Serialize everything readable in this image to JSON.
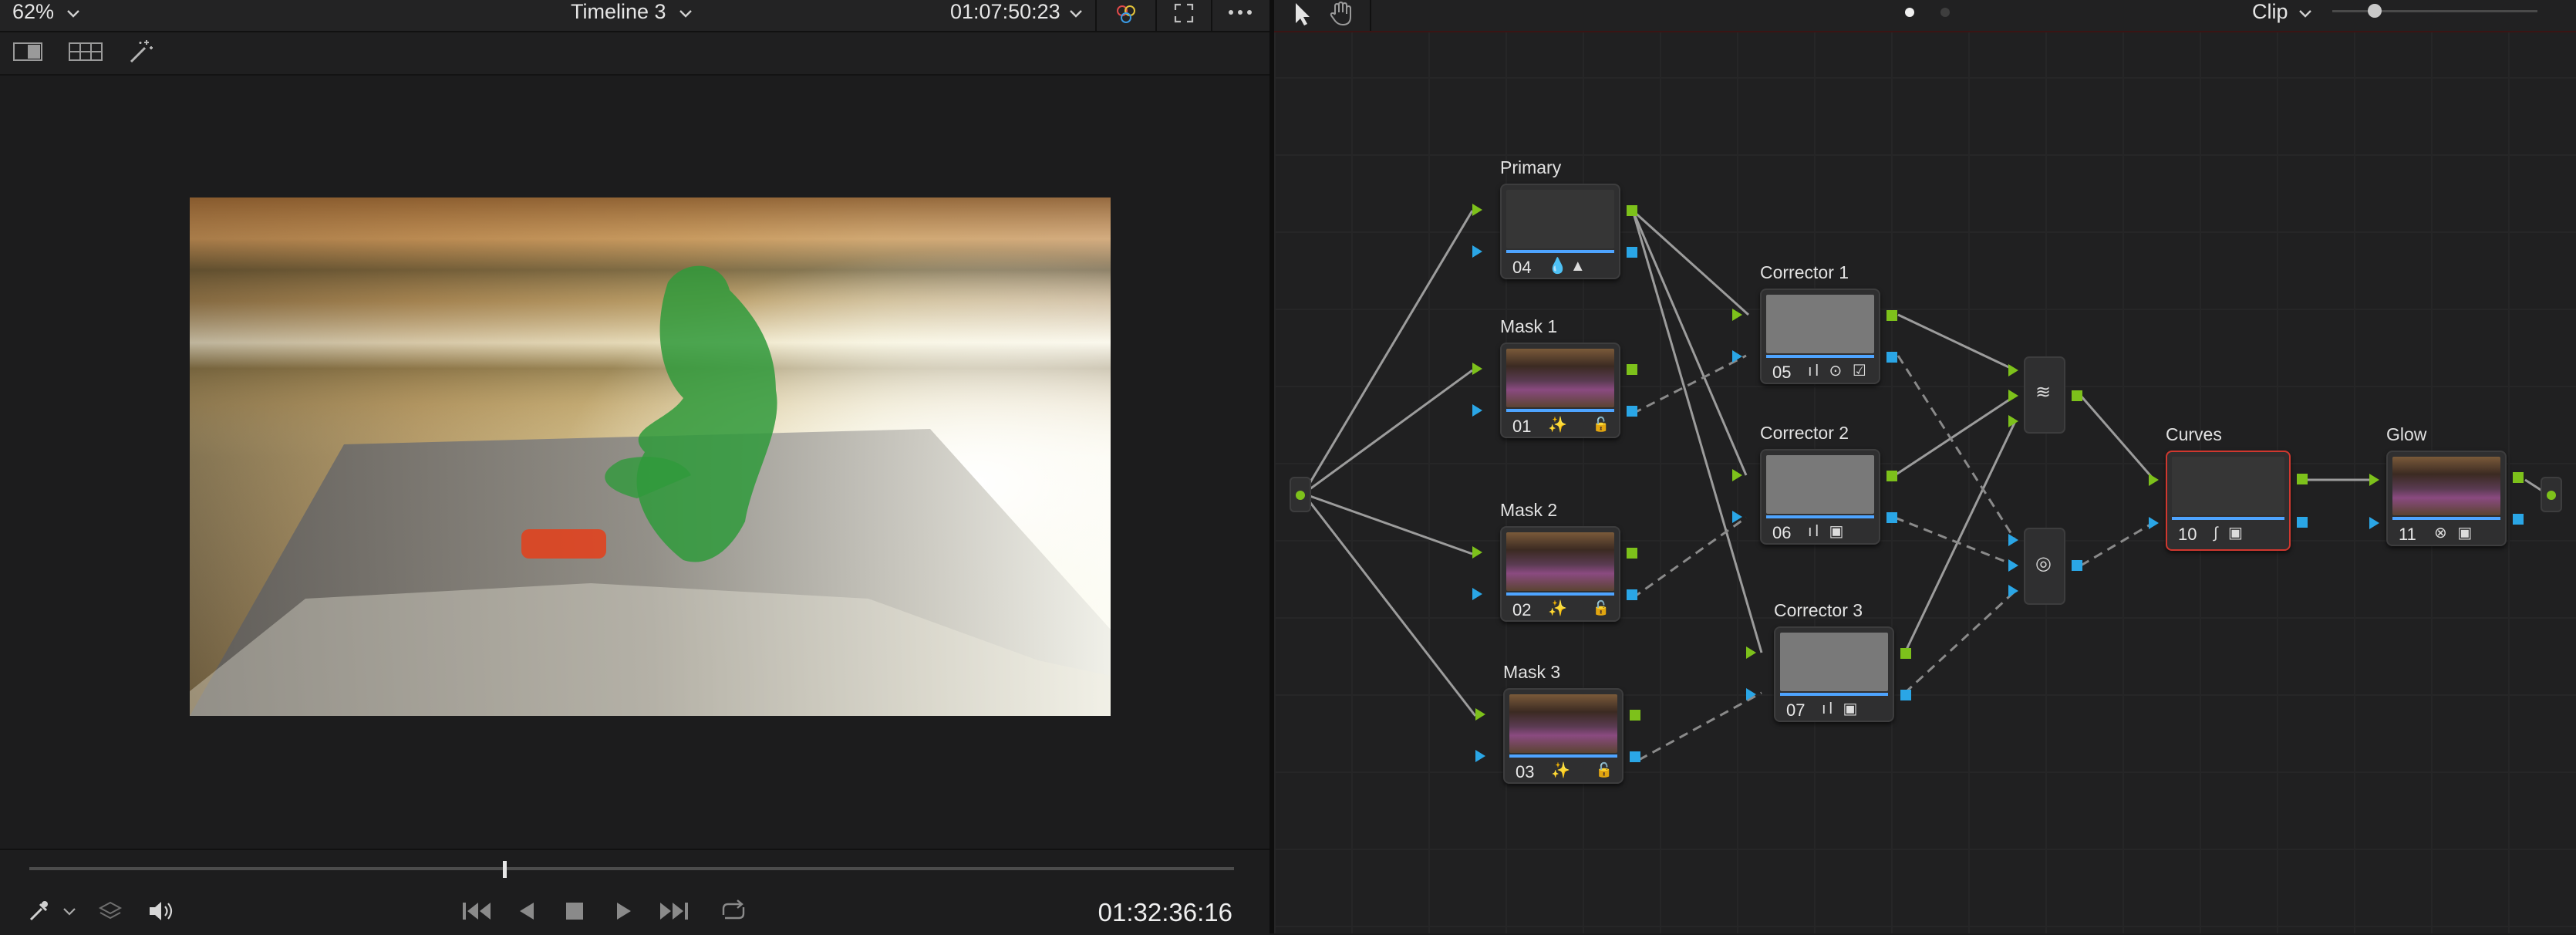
{
  "viewer": {
    "zoom": "62%",
    "timeline_title": "Timeline 3",
    "source_timecode": "01:07:50:23",
    "record_timecode": "01:32:36:16"
  },
  "nodegraph": {
    "mode_label": "Clip",
    "nodes": [
      {
        "label": "Primary",
        "number": "04"
      },
      {
        "label": "Mask 1",
        "number": "01"
      },
      {
        "label": "Mask 2",
        "number": "02"
      },
      {
        "label": "Mask 3",
        "number": "03"
      },
      {
        "label": "Corrector 1",
        "number": "05"
      },
      {
        "label": "Corrector 2",
        "number": "06"
      },
      {
        "label": "Corrector 3",
        "number": "07"
      },
      {
        "label": "Curves",
        "number": "10"
      },
      {
        "label": "Glow",
        "number": "11"
      }
    ]
  },
  "icons": {
    "zoom_dropdown": "chevron-down-icon",
    "timeline_dropdown": "chevron-down-icon",
    "color_picker": "color-wheel-icon",
    "fullscreen": "expand-icon",
    "more": "more-options-icon",
    "pointer": "pointer-icon",
    "hand": "hand-icon",
    "single_view": "single-viewer-icon",
    "grid_view": "grid-viewer-icon",
    "magic_wand": "magic-wand-icon",
    "picker": "eyedropper-icon",
    "layers": "layers-icon",
    "audio": "speaker-icon",
    "prev": "skip-back-icon",
    "reverse": "play-reverse-icon",
    "stop": "stop-icon",
    "play": "play-icon",
    "next": "skip-forward-icon",
    "loop": "loop-icon",
    "layer_mixer": "layer-mixer-icon",
    "key_mixer": "key-mixer-icon"
  },
  "colors": {
    "output_port_green": "#7dc11b",
    "output_port_blue": "#2aa6e6",
    "selected_border": "#d0382f",
    "node_underline": "#4ea4ff"
  }
}
